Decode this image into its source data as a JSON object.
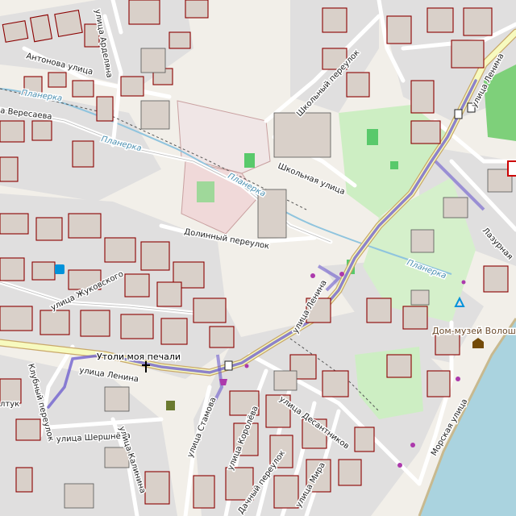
{
  "map": {
    "streets": [
      {
        "id": "antonova",
        "label": "Антонова улица"
      },
      {
        "id": "ardelyana",
        "label": "улица Арделяна"
      },
      {
        "id": "veresaeva",
        "label": "а Вересаева"
      },
      {
        "id": "planerka1",
        "label": "Планерка"
      },
      {
        "id": "planerka2",
        "label": "Планерка"
      },
      {
        "id": "planerka3",
        "label": "Планерка"
      },
      {
        "id": "planerka4",
        "label": "Планерка"
      },
      {
        "id": "shkolny",
        "label": "Школьный переулок"
      },
      {
        "id": "shkolnaya",
        "label": "Школьная улица"
      },
      {
        "id": "dolinny",
        "label": "Долинный переулок"
      },
      {
        "id": "zhukovskogo",
        "label": "улица Жуковского"
      },
      {
        "id": "lenina1",
        "label": "улица Ленина"
      },
      {
        "id": "lenina2",
        "label": "улица Ленина"
      },
      {
        "id": "lenina3",
        "label": "улица Ленина"
      },
      {
        "id": "lazurnaya",
        "label": "Лазурная"
      },
      {
        "id": "klubny",
        "label": "Клубный переулок"
      },
      {
        "id": "shershneva",
        "label": "улица Шершнёва"
      },
      {
        "id": "kalinina",
        "label": "улица Калинина"
      },
      {
        "id": "stamova",
        "label": "улица Стамова"
      },
      {
        "id": "koroleva",
        "label": "улица Королёва"
      },
      {
        "id": "desantnikov",
        "label": "улица Десантников"
      },
      {
        "id": "morskaya",
        "label": "Морская улица"
      },
      {
        "id": "dachny",
        "label": "Дачный переулок"
      },
      {
        "id": "mira",
        "label": "улица Мира"
      },
      {
        "id": "tutk",
        "label": "лтук"
      }
    ],
    "pois": {
      "church": "Утоли моя печали",
      "museum": "Дом-музей Волошина"
    },
    "colors": {
      "background": "#f2efe9",
      "building_outline": "#8b0000",
      "park": "#c8f0c0",
      "sea": "#aad3df",
      "route": "#6a5acd",
      "school": "#f0d9d9"
    },
    "icons": [
      "bus-stop-icon",
      "church-icon",
      "museum-icon",
      "campsite-icon",
      "shop-icon",
      "hospital-icon",
      "toilet-icon"
    ]
  }
}
